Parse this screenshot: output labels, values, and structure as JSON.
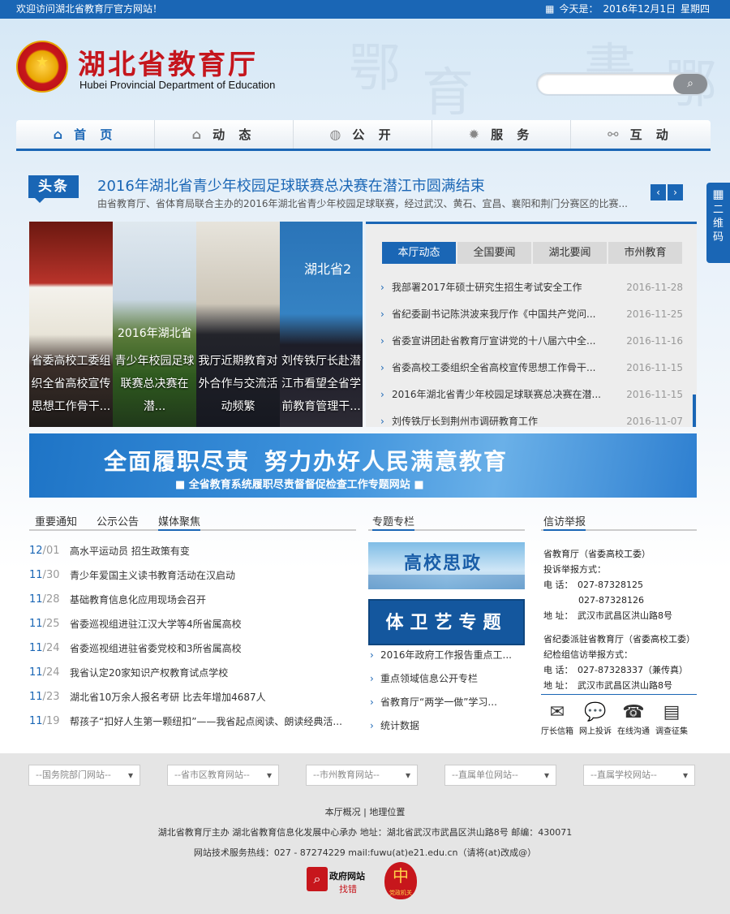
{
  "topbar": {
    "welcome": "欢迎访问湖北省教育厅官方网站！",
    "today_label": "今天是：",
    "date": "2016年12月1日",
    "weekday": "星期四"
  },
  "header": {
    "title_cn": "湖北省教育厅",
    "title_en": "Hubei Provincial Department of Education",
    "search_placeholder": ""
  },
  "nav": [
    {
      "label": "首 页",
      "icon": "home-icon"
    },
    {
      "label": "动 态",
      "icon": "bank-icon"
    },
    {
      "label": "公 开",
      "icon": "globe-icon"
    },
    {
      "label": "服 务",
      "icon": "gear-icon"
    },
    {
      "label": "互 动",
      "icon": "share-icon"
    }
  ],
  "headline": {
    "tag": "头条",
    "title": "2016年湖北省青少年校园足球联赛总决赛在潜江市圆满结束",
    "summary": "由省教育厅、省体育局联合主办的2016年湖北省青少年校园足球联赛，经过武汉、黄石、宜昌、襄阳和荆门分赛区的比赛..."
  },
  "side_qr": "二维码",
  "slides": [
    {
      "caption": "省委高校工委组织全省高校宣传思想工作骨干..."
    },
    {
      "overlay": "2016年湖北省",
      "caption": "青少年校园足球联赛总决赛在潜..."
    },
    {
      "caption": "我厅近期教育对外合作与交流活动频繁"
    },
    {
      "overlay": "湖北省2",
      "caption": "刘传铁厅长赴潜江市看望全省学前教育管理干..."
    }
  ],
  "newsbox": {
    "tabs": [
      "本厅动态",
      "全国要闻",
      "湖北要闻",
      "市州教育"
    ],
    "items": [
      {
        "title": "我部署2017年硕士研究生招生考试安全工作",
        "date": "2016-11-28"
      },
      {
        "title": "省纪委副书记陈洪波来我厅作《中国共产党问...",
        "date": "2016-11-25"
      },
      {
        "title": "省委宣讲团赴省教育厅宣讲党的十八届六中全...",
        "date": "2016-11-16"
      },
      {
        "title": "省委高校工委组织全省高校宣传思想工作骨干...",
        "date": "2016-11-15"
      },
      {
        "title": "2016年湖北省青少年校园足球联赛总决赛在潜...",
        "date": "2016-11-15"
      },
      {
        "title": "刘传铁厅长到荆州市调研教育工作",
        "date": "2016-11-07"
      }
    ]
  },
  "banner": {
    "part1": "全面履职尽责",
    "part2": "努力办好人民满意教育",
    "sub": "■ 全省教育系统履职尽责督督促检查工作专题网站 ■"
  },
  "notices": {
    "tabs": [
      "重要通知",
      "公示公告",
      "媒体聚焦"
    ],
    "items": [
      {
        "m": "12",
        "d": "01",
        "title": "高水平运动员 招生政策有变"
      },
      {
        "m": "11",
        "d": "30",
        "title": "青少年爱国主义读书教育活动在汉启动"
      },
      {
        "m": "11",
        "d": "28",
        "title": "基础教育信息化应用现场会召开"
      },
      {
        "m": "11",
        "d": "25",
        "title": "省委巡视组进驻江汉大学等4所省属高校"
      },
      {
        "m": "11",
        "d": "24",
        "title": "省委巡视组进驻省委党校和3所省属高校"
      },
      {
        "m": "11",
        "d": "24",
        "title": "我省认定20家知识产权教育试点学校"
      },
      {
        "m": "11",
        "d": "23",
        "title": "湖北省10万余人报名考研 比去年增加4687人"
      },
      {
        "m": "11",
        "d": "19",
        "title": "帮孩子“扣好人生第一颗纽扣”——我省起点阅读、朗读经典活..."
      }
    ]
  },
  "special": {
    "title": "专题专栏",
    "gx": "高校思政",
    "twy": "体卫艺专题",
    "items": [
      "2016年政府工作报告重点工...",
      "重点领域信息公开专栏",
      "省教育厅“两学一做”学习...",
      "统计数据"
    ]
  },
  "report": {
    "title": "信访举报",
    "org1": "省教育厅（省委高校工委）",
    "line1": "投诉举报方式：",
    "tel_label": "电 话：",
    "tel1": "027-87328125",
    "tel2": "027-87328126",
    "addr_label": "地 址：",
    "addr": "武汉市武昌区洪山路8号",
    "org2": "省纪委派驻省教育厅（省委高校工委）",
    "line2": "纪检组信访举报方式：",
    "tel3": "027-87328337（兼传真）",
    "icons": [
      {
        "label": "厅长信箱",
        "icon": "mail-icon"
      },
      {
        "label": "网上投诉",
        "icon": "chat-icon"
      },
      {
        "label": "在线沟通",
        "icon": "phone-icon"
      },
      {
        "label": "调查征集",
        "icon": "survey-icon"
      }
    ]
  },
  "footer": {
    "selects": [
      "--国务院部门网站--",
      "--省市区教育网站--",
      "--市州教育网站--",
      "--直属单位网站--",
      "--直属学校网站--"
    ],
    "links": "本厅概况 | 地理位置",
    "host": "湖北省教育厅主办 湖北省教育信息化发展中心承办 地址：湖北省武汉市武昌区洪山路8号 邮编：430071",
    "hotline": "网站技术服务热线：027 - 87274229 mail:fuwu(at)e21.edu.cn（请将(at)改成@）",
    "gov_t1": "政府网站",
    "gov_t2": "找错",
    "party": "党政机关"
  }
}
